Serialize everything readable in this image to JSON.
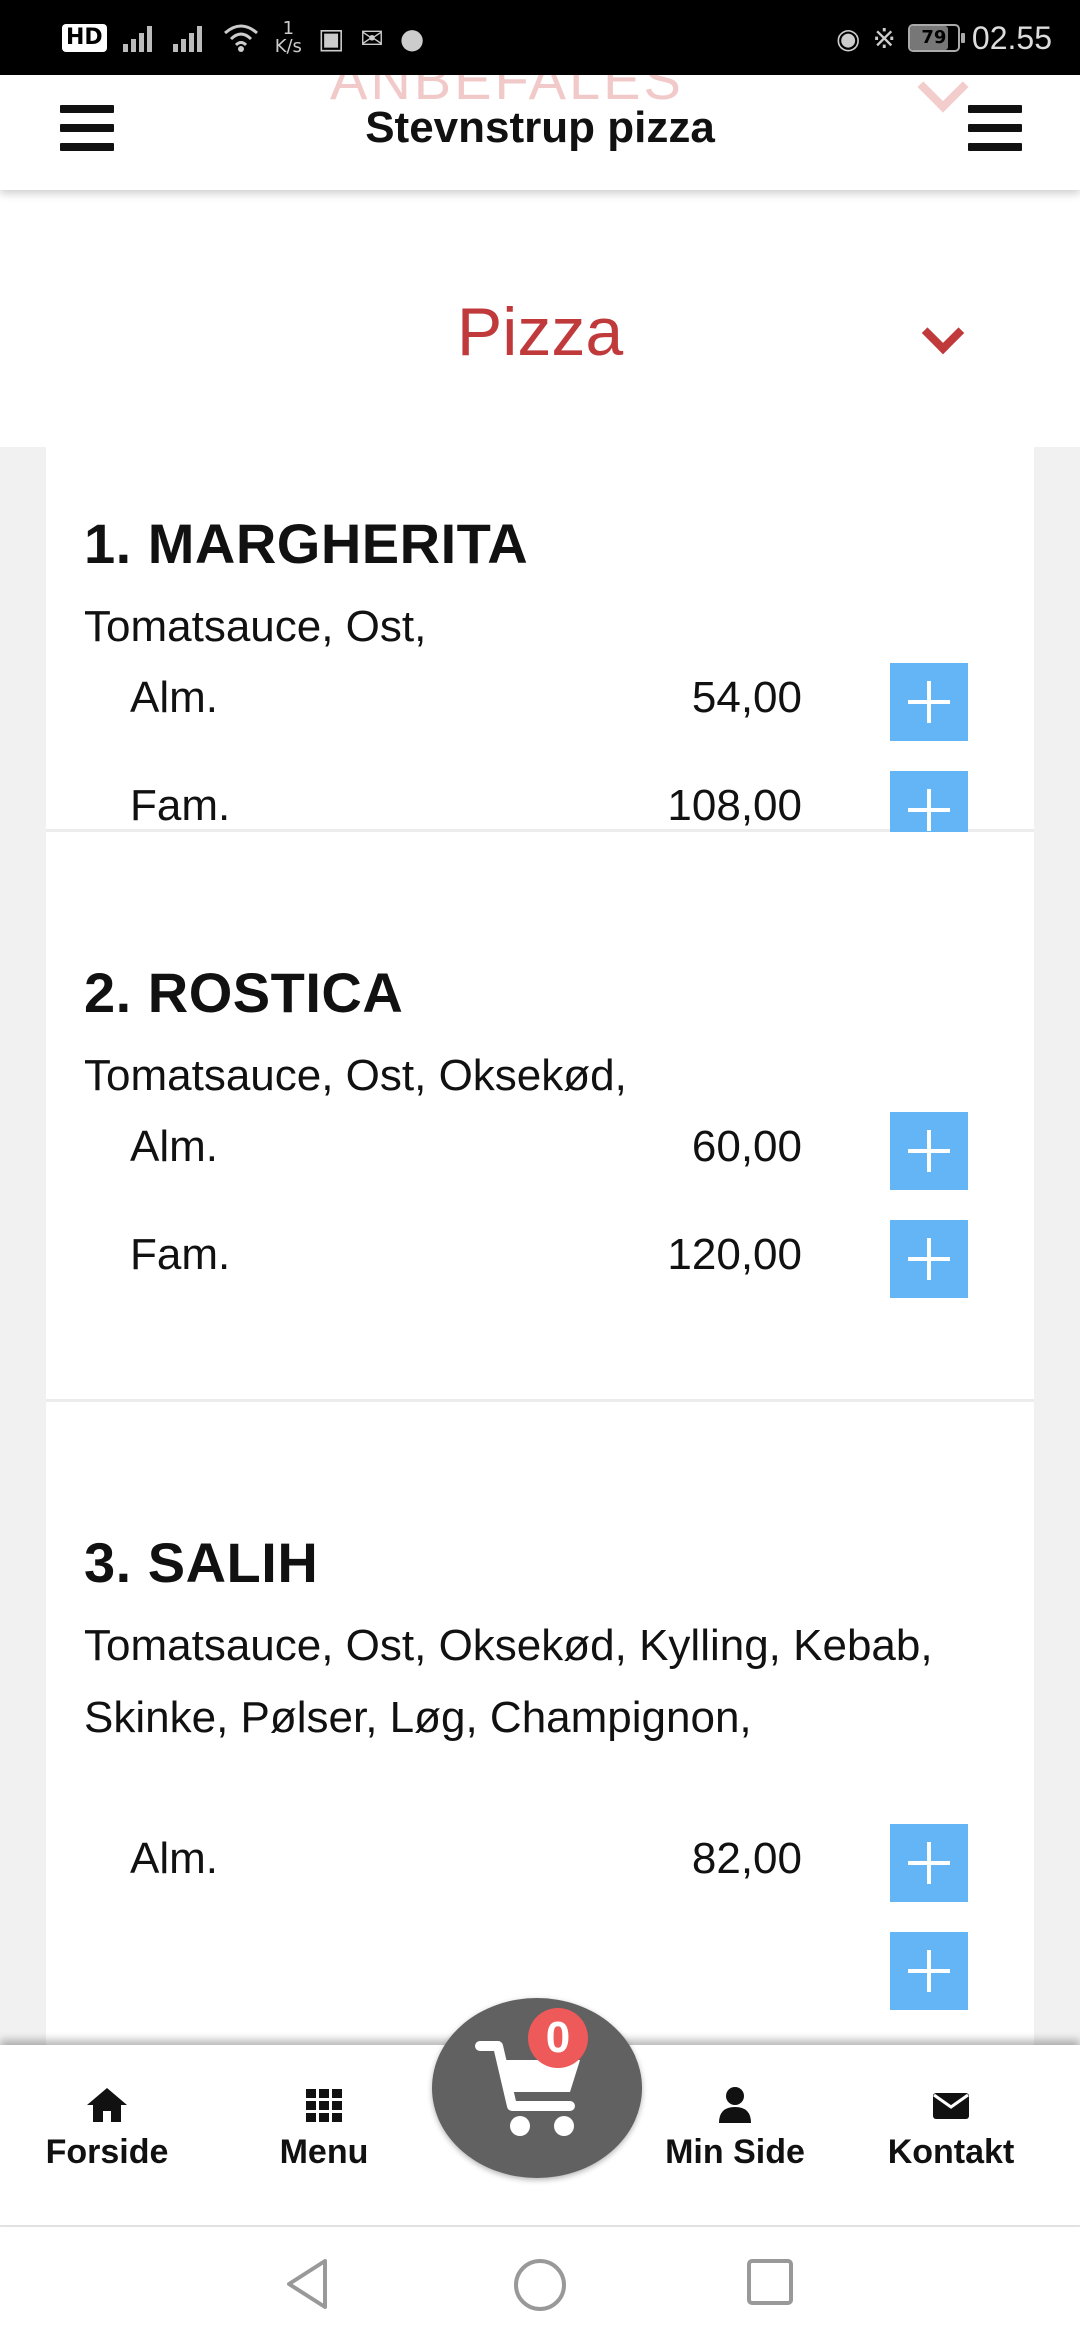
{
  "status_bar": {
    "hd": "HD",
    "speed_value": "1",
    "speed_unit": "K/s",
    "battery": "79",
    "time": "02.55"
  },
  "header": {
    "background_text": "ANBEFALES",
    "title": "Stevnstrup pizza"
  },
  "category": {
    "title": "Pizza",
    "accent": "#c0393b"
  },
  "menu_items": [
    {
      "title": "1. MARGHERITA",
      "description": "Tomatsauce, Ost,",
      "prices": [
        {
          "size": "Alm.",
          "price": "54,00"
        },
        {
          "size": "Fam.",
          "price": "108,00"
        }
      ]
    },
    {
      "title": "2. ROSTICA",
      "description": "Tomatsauce, Ost, Oksekød,",
      "prices": [
        {
          "size": "Alm.",
          "price": "60,00"
        },
        {
          "size": "Fam.",
          "price": "120,00"
        }
      ]
    },
    {
      "title": "3. SALIH",
      "description": "Tomatsauce, Ost, Oksekød, Kylling, Kebab, Skinke, Pølser, Løg, Champignon,",
      "prices": [
        {
          "size": "Alm.",
          "price": "82,00"
        }
      ]
    }
  ],
  "bottom_nav": {
    "home": "Forside",
    "menu": "Menu",
    "cart_count": "0",
    "profile": "Min Side",
    "contact": "Kontakt"
  },
  "icons": {
    "add": "plus-icon",
    "home": "home-icon",
    "menu": "grid-icon",
    "cart": "cart-icon",
    "profile": "user-icon",
    "contact": "envelope-icon"
  },
  "colors": {
    "add_button": "#64b5f6",
    "cart_fab": "#616161",
    "cart_badge": "#ee5a5a"
  }
}
